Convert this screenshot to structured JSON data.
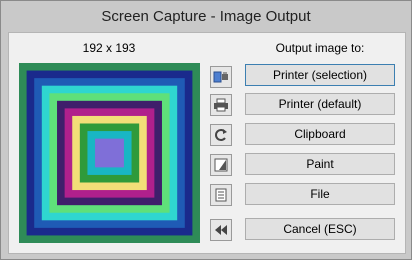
{
  "window": {
    "title": "Screen Capture - Image Output"
  },
  "preview": {
    "dimensions_text": "192 x 193",
    "ring_colors": [
      "#2e8b57",
      "#1a2a8c",
      "#1f5bb5",
      "#2fd6d0",
      "#5fe07a",
      "#3f1f6b",
      "#b0208c",
      "#f2de78",
      "#2f9a3a",
      "#19b6c4",
      "#7f6fd8"
    ]
  },
  "output": {
    "label": "Output image to:",
    "buttons": [
      {
        "label": "Printer (selection)",
        "icon": "printer-selection-icon"
      },
      {
        "label": "Printer (default)",
        "icon": "printer-icon"
      },
      {
        "label": "Clipboard",
        "icon": "clipboard-refresh-icon"
      },
      {
        "label": "Paint",
        "icon": "paint-icon"
      },
      {
        "label": "File",
        "icon": "file-icon"
      },
      {
        "label": "Cancel (ESC)",
        "icon": "rewind-icon"
      }
    ]
  }
}
